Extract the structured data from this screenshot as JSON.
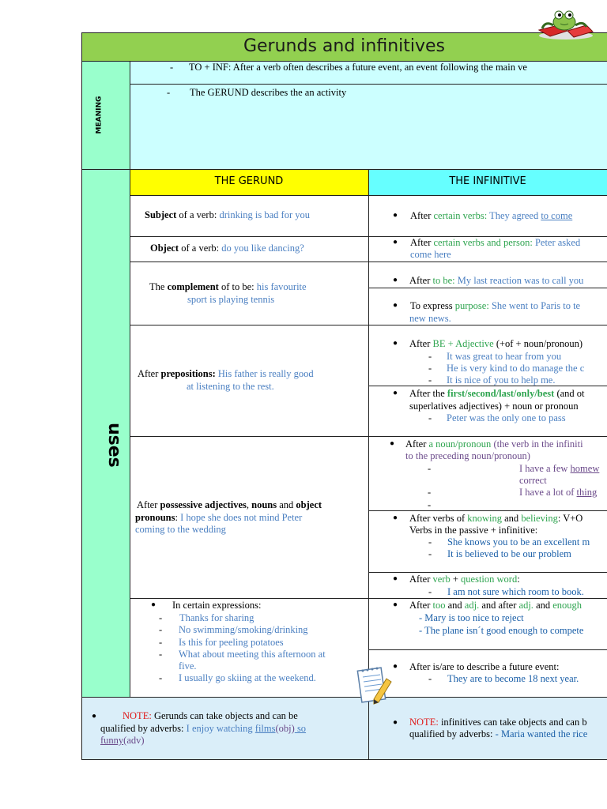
{
  "title": "Gerunds and infinitives",
  "meaning": {
    "side_label": "MEANING",
    "line1": "TO + INF: After a verb often describes a future event, an event following the main ve",
    "line2": "The GERUND describes the an activity"
  },
  "uses_label": "uses",
  "headers": {
    "gerund": "THE GERUND",
    "infinitive": "THE INFINITIVE"
  },
  "gerund": {
    "r1": {
      "bold": "Subject",
      "mid": " of a verb: ",
      "ex": "drinking is bad for you"
    },
    "r2": {
      "bold": "Object",
      "mid": " of a verb: ",
      "ex": "do you like dancing?"
    },
    "r3": {
      "pre": "The ",
      "bold": "complement",
      "mid": " of to be: ",
      "ex1": "his favourite",
      "ex2": "sport is playing tennis"
    },
    "r4": {
      "pre": "After ",
      "bold": "prepositions:",
      "ex1": " His father is really good",
      "ex2": "at listening to the rest."
    },
    "r5": {
      "pre": "After ",
      "b1": "possessive adjectives",
      "c1": ", ",
      "b2": "nouns",
      "c2": " and ",
      "b3": "object",
      "b4": "pronouns",
      "c3": ": ",
      "ex1": "I hope she does not mind Peter",
      "ex2": "coming to the wedding"
    },
    "r6": {
      "intro": "In certain expressions:",
      "items": [
        "Thanks for sharing",
        "No swimming/smoking/drinking",
        "Is this for peeling potatoes",
        "What about meeting this afternoon at",
        "five.",
        "I usually go skiing at the weekend."
      ]
    },
    "note": {
      "label": "NOTE:",
      "t1": " Gerunds can take objects and can be",
      "t2": "qualified by adverbs: ",
      "ex1": "I enjoy watching ",
      "films": "films",
      "obj": "(obj)",
      "so": " so",
      "funny": "funny",
      "adv": "(adv)"
    }
  },
  "infinitive": {
    "r1": {
      "pre": "After ",
      "g": "certain verbs:",
      "ex": " They agreed ",
      "u": "to come"
    },
    "r2": {
      "pre": "After ",
      "g": "certain verbs and person:",
      "ex": " Peter asked",
      "ex2": "come here"
    },
    "r3": {
      "pre": "After ",
      "g": "to be:",
      "ex": " My last reaction was to call you"
    },
    "r4": {
      "pre": "To express ",
      "g": "purpose:",
      "ex": "  She went to Paris to te",
      "ex2": "new news."
    },
    "r5": {
      "pre": "After ",
      "g": "BE + Adjective",
      "post": " (+of + noun/pronoun)",
      "items": [
        "It was great to hear from you",
        "He is very kind to do manage the c",
        "It is nice of you to help me."
      ]
    },
    "r6": {
      "pre": "After the ",
      "g": "first/second/last/only/best",
      "post": " (and ot",
      "l2": "superlatives adjectives) + noun or pronoun",
      "item": "Peter was the only one to pass"
    },
    "r7": {
      "pre": "After ",
      "g": "a noun/pronoun",
      "p": " (the verb in the infiniti",
      "l2": "to the preceding noun/pronoun)",
      "a1": "I have a few ",
      "a1u": "homew",
      "a2": "correct",
      "a3": "I have a lot of ",
      "a3u": "thing"
    },
    "r8": {
      "pre": "After verbs of ",
      "g1": "knowing",
      "and": " and ",
      "g2": "believing",
      "post": ": V+O",
      "l2": "Verbs in the passive + infinitive:",
      "items": [
        "She knows you to be an excellent m",
        "It is believed to be our problem"
      ]
    },
    "r9": {
      "pre": "After ",
      "g1": "verb",
      "plus": " + ",
      "g2": "question word",
      "colon": ":",
      "item": "I am not sure which room to book."
    },
    "r10": {
      "pre": "After ",
      "g1": "too",
      "and1": " and ",
      "g2": "adj.",
      "and2": " and after ",
      "g3": "adj.",
      "and3": " and ",
      "g4": "enough",
      "items": [
        "- Mary is too nice to reject",
        "- The plane isn´t good enough to compete"
      ]
    },
    "r11": {
      "t": "After is/are to describe a future event:",
      "item": "They are to become 18 next year."
    },
    "note": {
      "label": "NOTE:",
      "t1": " infinitives can take objects and can b",
      "t2": "qualified by adverbs:",
      "ex": " - Maria wanted the rice"
    }
  },
  "colors": {
    "title_bg": "#92d050",
    "mint": "#99ffcc",
    "yellow": "#ffff00",
    "cyan": "#66ffff",
    "light_cyan": "#ccffff",
    "note_bg": "#daeef9",
    "example_blue": "#4a7fc1",
    "green": "#2ea44f",
    "red": "#e01515"
  },
  "icons": {
    "frog": "frog-reading-icon",
    "notepad": "notepad-pencil-icon"
  }
}
